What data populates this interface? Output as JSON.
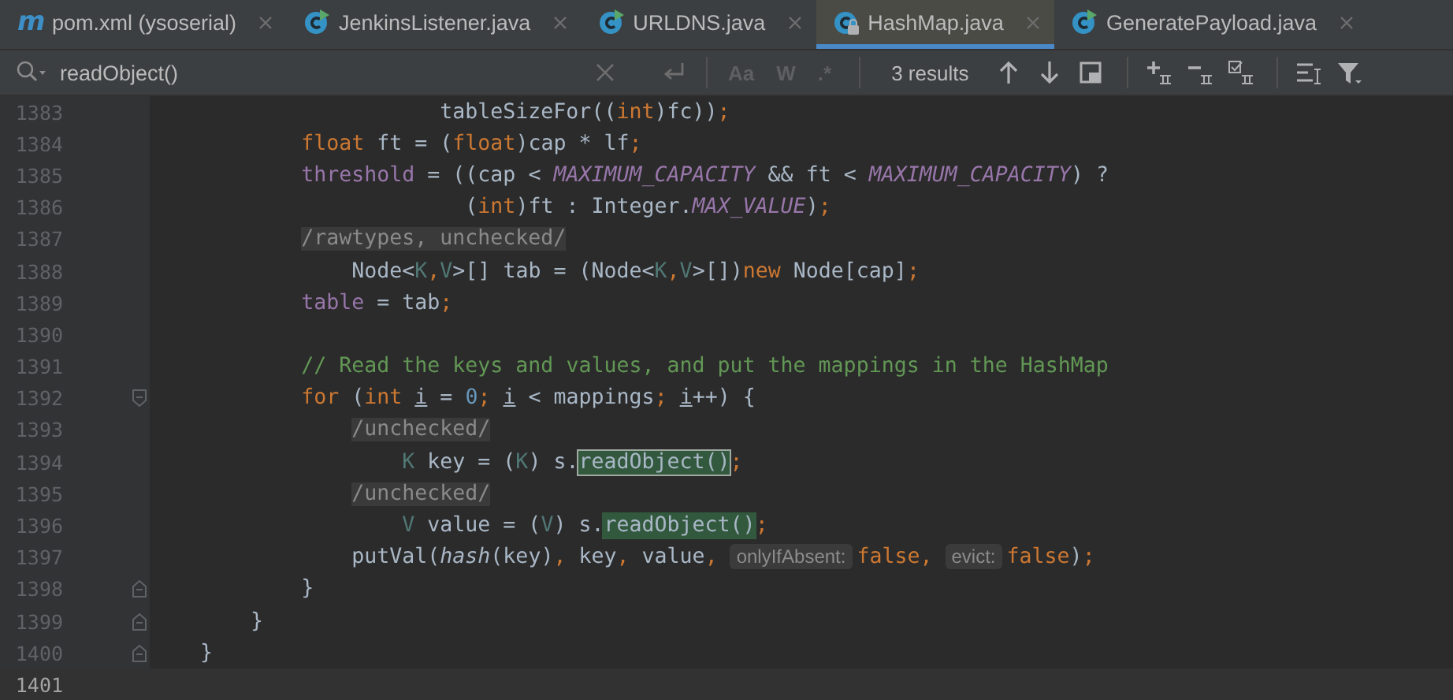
{
  "tabs": [
    {
      "label": "pom.xml (ysoserial)",
      "kind": "maven",
      "glyph": "m",
      "selected": false
    },
    {
      "label": "JenkinsListener.java",
      "kind": "class-runnable",
      "selected": false
    },
    {
      "label": "URLDNS.java",
      "kind": "class-runnable",
      "selected": false
    },
    {
      "label": "HashMap.java",
      "kind": "class-locked",
      "selected": true
    },
    {
      "label": "GeneratePayload.java",
      "kind": "class-runnable",
      "selected": false
    }
  ],
  "search": {
    "value": "readObject()",
    "options": [
      {
        "label": "Aa",
        "selected": false
      },
      {
        "label": "W",
        "selected": false
      },
      {
        "label": ".*",
        "selected": false
      }
    ],
    "result_count": "3 results"
  },
  "editor": {
    "lines": [
      {
        "number": "1383",
        "kind": "code",
        "current": false,
        "tokens": [
          {
            "text": "                       tableSizeFor((",
            "kind": "plain"
          },
          {
            "text": "int",
            "kind": "keyword"
          },
          {
            "text": ")fc))",
            "kind": "plain"
          },
          {
            "text": ";",
            "kind": "keyword"
          }
        ]
      },
      {
        "number": "1384",
        "kind": "code",
        "current": false,
        "tokens": [
          {
            "text": "            float",
            "kind": "keyword"
          },
          {
            "text": " ft = (",
            "kind": "plain"
          },
          {
            "text": "float",
            "kind": "keyword"
          },
          {
            "text": ")cap * lf",
            "kind": "plain"
          },
          {
            "text": ";",
            "kind": "keyword"
          }
        ]
      },
      {
        "number": "1385",
        "kind": "code",
        "current": false,
        "tokens": [
          {
            "text": "            threshold",
            "kind": "field"
          },
          {
            "text": " = ((cap < ",
            "kind": "plain"
          },
          {
            "text": "MAXIMUM_CAPACITY",
            "kind": "constant"
          },
          {
            "text": " && ft < ",
            "kind": "plain"
          },
          {
            "text": "MAXIMUM_CAPACITY",
            "kind": "constant"
          },
          {
            "text": ") ?",
            "kind": "plain"
          }
        ]
      },
      {
        "number": "1386",
        "kind": "code",
        "current": false,
        "tokens": [
          {
            "text": "                         (",
            "kind": "plain"
          },
          {
            "text": "int",
            "kind": "keyword"
          },
          {
            "text": ")ft : Integer.",
            "kind": "plain"
          },
          {
            "text": "MAX_VALUE",
            "kind": "constant"
          },
          {
            "text": ")",
            "kind": "plain"
          },
          {
            "text": ";",
            "kind": "keyword"
          }
        ]
      },
      {
        "number": "1387",
        "kind": "code",
        "current": false,
        "tokens": [
          {
            "text": "            /rawtypes, unchecked/",
            "kind": "folded"
          }
        ]
      },
      {
        "number": "1388",
        "kind": "code",
        "current": false,
        "tokens": [
          {
            "text": "                Node<",
            "kind": "plain"
          },
          {
            "text": "K",
            "kind": "type-param"
          },
          {
            "text": ",",
            "kind": "keyword"
          },
          {
            "text": "V",
            "kind": "type-param"
          },
          {
            "text": ">[] tab = (Node<",
            "kind": "plain"
          },
          {
            "text": "K",
            "kind": "type-param"
          },
          {
            "text": ",",
            "kind": "keyword"
          },
          {
            "text": "V",
            "kind": "type-param"
          },
          {
            "text": ">[])",
            "kind": "plain"
          },
          {
            "text": "new",
            "kind": "keyword"
          },
          {
            "text": " Node[cap]",
            "kind": "plain"
          },
          {
            "text": ";",
            "kind": "keyword"
          }
        ]
      },
      {
        "number": "1389",
        "kind": "code",
        "current": false,
        "tokens": [
          {
            "text": "            table",
            "kind": "field"
          },
          {
            "text": " = tab",
            "kind": "plain"
          },
          {
            "text": ";",
            "kind": "keyword"
          }
        ]
      },
      {
        "number": "1390",
        "kind": "code",
        "current": false
      },
      {
        "number": "1391",
        "kind": "code",
        "current": false,
        "tokens": [
          {
            "text": "            // Read the keys and values, and put the mappings in the HashMap",
            "kind": "comment"
          }
        ]
      },
      {
        "number": "1392",
        "kind": "fold-start",
        "current": false,
        "tokens": [
          {
            "text": "            for",
            "kind": "keyword"
          },
          {
            "text": " (",
            "kind": "plain"
          },
          {
            "text": "int ",
            "kind": "keyword"
          },
          {
            "text": "i",
            "kind": "reassigned"
          },
          {
            "text": " = ",
            "kind": "plain"
          },
          {
            "text": "0",
            "kind": "number"
          },
          {
            "text": "; ",
            "kind": "keyword"
          },
          {
            "text": "i",
            "kind": "reassigned"
          },
          {
            "text": " < mappings",
            "kind": "plain"
          },
          {
            "text": "; ",
            "kind": "keyword"
          },
          {
            "text": "i",
            "kind": "reassigned"
          },
          {
            "text": "++) {",
            "kind": "plain"
          }
        ]
      },
      {
        "number": "1393",
        "kind": "code",
        "current": false,
        "tokens": [
          {
            "text": "                /unchecked/",
            "kind": "folded"
          }
        ]
      },
      {
        "number": "1394",
        "kind": "code",
        "current": false,
        "tokens": [
          {
            "text": "                    K",
            "kind": "type-param"
          },
          {
            "text": " key = (",
            "kind": "plain"
          },
          {
            "text": "K",
            "kind": "type-param"
          },
          {
            "text": ") s.",
            "kind": "plain"
          },
          {
            "text": "readObject()",
            "kind": "match",
            "selected": true
          },
          {
            "text": ";",
            "kind": "keyword"
          }
        ]
      },
      {
        "number": "1395",
        "kind": "code",
        "current": false,
        "tokens": [
          {
            "text": "                /unchecked/",
            "kind": "folded"
          }
        ]
      },
      {
        "number": "1396",
        "kind": "code",
        "current": false,
        "tokens": [
          {
            "text": "                    V",
            "kind": "type-param"
          },
          {
            "text": " value = (",
            "kind": "plain"
          },
          {
            "text": "V",
            "kind": "type-param"
          },
          {
            "text": ") s.",
            "kind": "plain"
          },
          {
            "text": "readObject()",
            "kind": "match",
            "selected": false
          },
          {
            "text": ";",
            "kind": "keyword"
          }
        ]
      },
      {
        "number": "1397",
        "kind": "code",
        "current": false,
        "tokens": [
          {
            "text": "                putVal(",
            "kind": "plain"
          },
          {
            "text": "hash",
            "kind": "static-call"
          },
          {
            "text": "(key)",
            "kind": "plain"
          },
          {
            "text": ",",
            "kind": "keyword"
          },
          {
            "text": " key",
            "kind": "plain"
          },
          {
            "text": ",",
            "kind": "keyword"
          },
          {
            "text": " value",
            "kind": "plain"
          },
          {
            "text": ", ",
            "kind": "keyword"
          },
          {
            "text": "onlyIfAbsent:",
            "kind": "hint"
          },
          {
            "text": "false",
            "kind": "keyword"
          },
          {
            "text": ", ",
            "kind": "keyword"
          },
          {
            "text": "evict:",
            "kind": "hint"
          },
          {
            "text": "false",
            "kind": "keyword"
          },
          {
            "text": ")",
            "kind": "plain"
          },
          {
            "text": ";",
            "kind": "keyword"
          }
        ]
      },
      {
        "number": "1398",
        "kind": "fold-end",
        "current": false,
        "tokens": [
          {
            "text": "            }",
            "kind": "plain"
          }
        ]
      },
      {
        "number": "1399",
        "kind": "fold-end",
        "current": false,
        "tokens": [
          {
            "text": "        }",
            "kind": "plain"
          }
        ]
      },
      {
        "number": "1400",
        "kind": "fold-end",
        "current": false,
        "tokens": [
          {
            "text": "    }",
            "kind": "plain"
          }
        ]
      },
      {
        "number": "1401",
        "kind": "code",
        "current": true
      }
    ]
  }
}
